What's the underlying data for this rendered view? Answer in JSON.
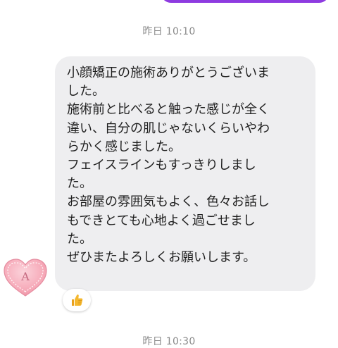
{
  "conversation": {
    "timestamps": [
      "昨日 10:10",
      "昨日 10:30"
    ],
    "message": {
      "lines": [
        "小顔矯正の施術ありがとうございま",
        "した。",
        "施術前と比べると触った感じが全く",
        "違い、自分の肌じゃないくらいやわ",
        "らかく感じました。",
        "フェイスラインもすっきりしまし",
        "た。",
        "お部屋の雰囲気もよく、色々お話し",
        "もできとても心地よく過ごせまし",
        "た。",
        "ぜひまたよろしくお願いします。"
      ]
    },
    "avatar": {
      "letter": "A",
      "icon": "heart-icon"
    },
    "reaction": {
      "icon": "thumbs-up-icon"
    }
  },
  "colors": {
    "sent_bubble": "#8e3be0",
    "received_bubble": "#eeeef0",
    "timestamp_text": "#8a8a8a",
    "avatar_heart": "#f6a9b8",
    "reaction_emoji": "#f5b82e"
  }
}
